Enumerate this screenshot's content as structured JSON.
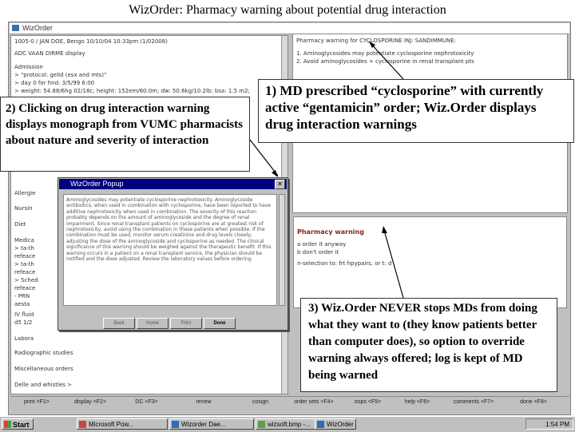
{
  "slide": {
    "title": "WizOrder:  Pharmacy warning about potential drug interaction"
  },
  "app_window": {
    "title": "WizOrder",
    "left_pane": {
      "patient_line": "1005-0 / JAN DOE, Bengo 10/10/04 10:33pm (1/02008)",
      "view_heading": "ADC VAAN DIRME display",
      "lines": [
        "Admission",
        "> \"protocol: gelid (esx and mts)\"",
        "> day 0 for hnd: 3/5/99 6:00",
        "> weight: 54.88/6hg 02/18c; height: 152em/60.0m; dw: 50.6kg/10.2lb; bsa: 1.5 m2;"
      ],
      "lower_lines": [
        "Allergie",
        "Nursin",
        "Diet",
        "Medica",
        "> ta-th",
        "  refeace",
        "> ta-th",
        "  refeace",
        "> Sched",
        "  refeace",
        "- PRN",
        "  aesta",
        "IV fluid",
        "  d5 1/2",
        "Labora"
      ],
      "bottom_lines": [
        "Radiographic studies",
        "Miscellaneous orders",
        "Delle and whistles >"
      ]
    },
    "right_pane_top": {
      "heading": "Pharmacy warning for CYCLOSPORINE INJ: SANDIMMUNE:",
      "lines": [
        "1. Aminoglycosides may potentiate cyclosporine nephrotoxicity",
        "2. Avoid aminoglycosides + cyclosporine in renal transplant pts"
      ]
    },
    "right_pane_bottom": {
      "heading": "Pharmacy warning",
      "options": [
        "a   order it anyway",
        "b   don't order it"
      ],
      "note": "n-selection to: frt hpypairs, or t: d"
    },
    "function_bar": [
      "print  <F1>",
      "display  <F2>",
      "DC  <F3>",
      "renew",
      "cosign",
      "order sets <F4>",
      "oops  <F5>",
      "help  <F6>",
      "comments <F7>",
      "done  <F8>"
    ]
  },
  "popup": {
    "title": "WizOrder Popup",
    "text": "Aminoglycosides may potentiate cyclosporine nephrotoxicity. Aminoglycoside antibiotics, when used in combination with cyclosporine, have been reported to have additive nephrotoxicity when used in combination. The severity of this reaction probably depends on the amount of aminoglycoside and the degree of renal impairment. Since renal transplant patients on cyclosporine are at greatest risk of nephrotoxicity, avoid using the combination in these patients when possible. If the combination must be used, monitor serum creatinine and drug levels closely, adjusting the dose of the aminoglycoside and cyclosporine as needed. The clinical significance of this warning should be weighed against the therapeutic benefit. If this warning occurs in a patient on a renal transplant service, the physician should be notified and the dose adjusted. Review the laboratory values before ordering.",
    "buttons": [
      "Back",
      "Home",
      "Print",
      "Done"
    ]
  },
  "callouts": {
    "c1": "1) MD prescribed “cyclosporine” with currently active “gentamicin” order; Wiz.Order displays drug interaction warnings",
    "c2": "2) Clicking on drug interaction warning displays monograph from VUMC pharmacists about nature and severity of interaction",
    "c3": "3) Wiz.Order NEVER stops MDs from doing what they want to (they know patients better than computer does), so option to override warning always offered; log is kept of MD being warned"
  },
  "taskbar": {
    "start": "Start",
    "tasks": [
      "Microsoft Pow...",
      "Wizorder Dae...",
      "wizsoft.bmp -...",
      "WizOrder"
    ],
    "clock": "1:54 PM"
  },
  "colors": {
    "popup_titlebar": "#000080",
    "warning_heading": "#8a2020",
    "desktop_gray": "#c0c0c0"
  }
}
